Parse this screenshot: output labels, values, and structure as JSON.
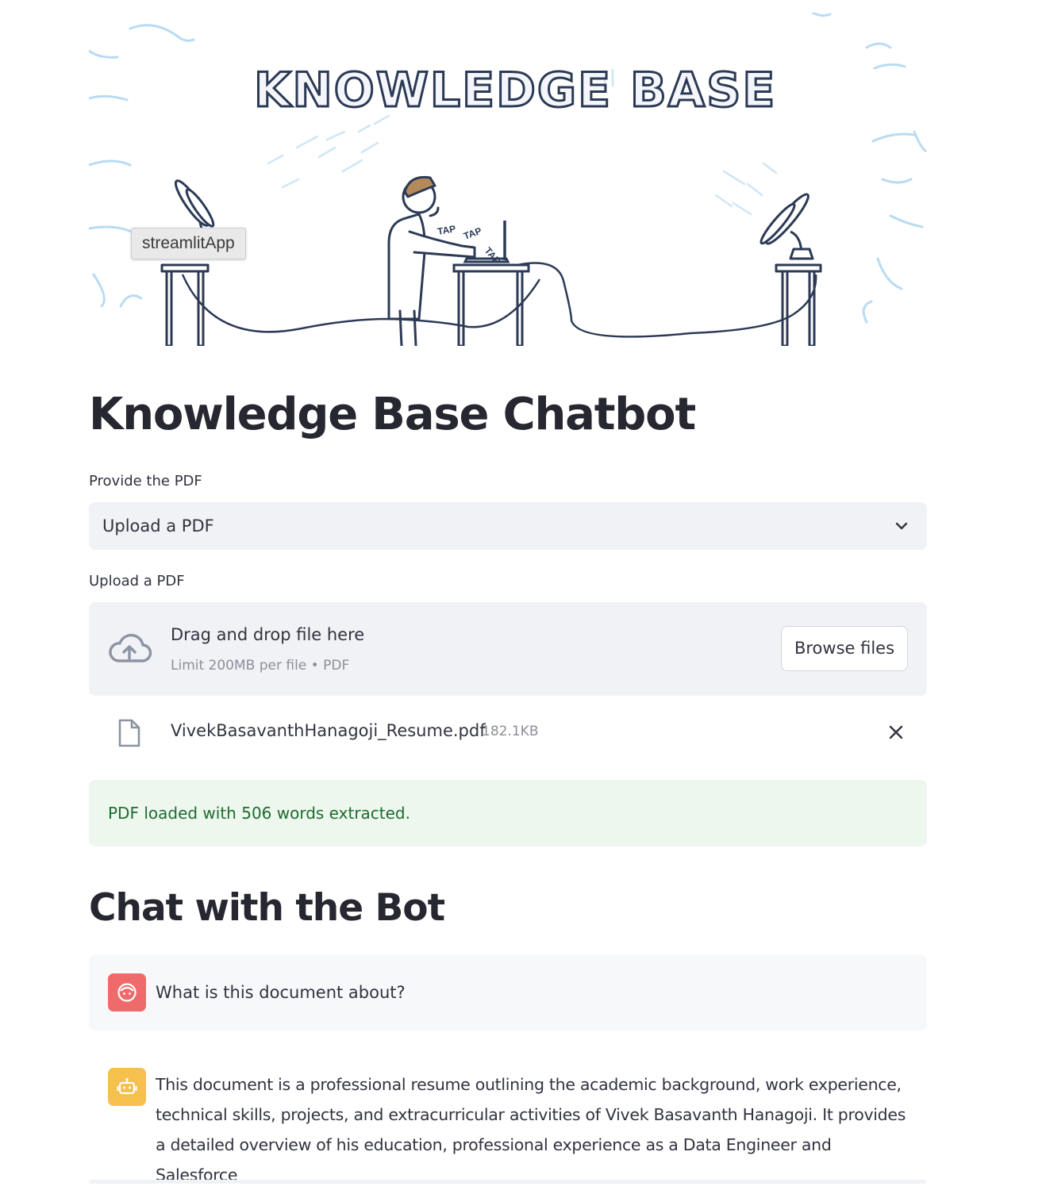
{
  "banner": {
    "heading": "KNOWLEDGE BASE",
    "tap_words": [
      "TAP",
      "TAP",
      "TAP"
    ],
    "tooltip": "streamlitApp"
  },
  "page": {
    "title": "Knowledge Base Chatbot"
  },
  "source_select": {
    "label": "Provide the PDF",
    "value": "Upload a PDF",
    "icon": "chevron-down-icon"
  },
  "uploader": {
    "label": "Upload a PDF",
    "drop_text": "Drag and drop file here",
    "limit_text": "Limit 200MB per file • PDF",
    "browse_label": "Browse files",
    "icon": "cloud-upload-icon"
  },
  "uploaded_file": {
    "name": "VivekBasavanthHanagoji_Resume.pdf",
    "size": "182.1KB",
    "icon": "file-icon",
    "remove_icon": "close-icon"
  },
  "status": {
    "message": "PDF loaded with 506 words extracted.",
    "color": "#1e6b2f",
    "background": "#edf7ee"
  },
  "chat": {
    "heading": "Chat with the Bot",
    "messages": [
      {
        "role": "user",
        "avatar": "user-face-icon",
        "avatar_color": "#ef6b6b",
        "text": "What is this document about?"
      },
      {
        "role": "assistant",
        "avatar": "robot-icon",
        "avatar_color": "#f6c04f",
        "text": "This document is a professional resume outlining the academic background, work experience, technical skills, projects, and extracurricular activities of Vivek Basavanth Hanagoji. It provides a detailed overview of his education, professional experience as a Data Engineer and Salesforce"
      }
    ]
  }
}
